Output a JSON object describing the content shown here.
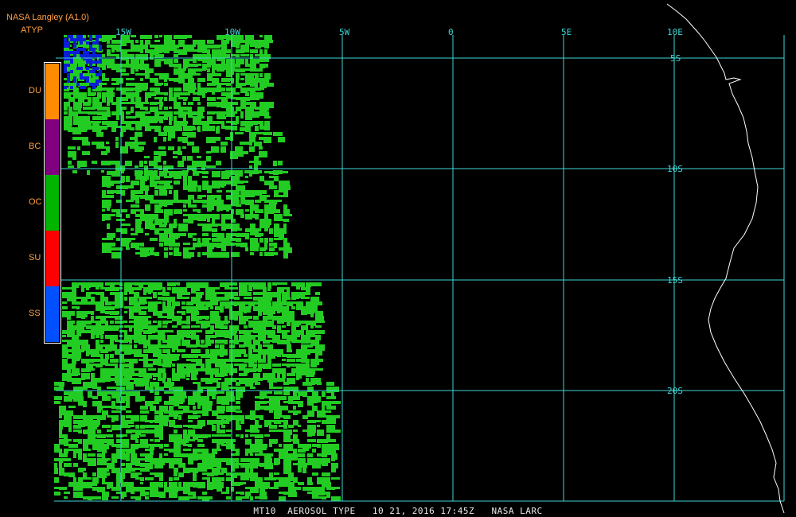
{
  "header": {
    "source": "NASA Langley (A1.0)",
    "product": "ATYP"
  },
  "legend": [
    {
      "label": "DU",
      "color": "#ff8c00"
    },
    {
      "label": "BC",
      "color": "#800080"
    },
    {
      "label": "OC",
      "color": "#00b400"
    },
    {
      "label": "SU",
      "color": "#ff0000"
    },
    {
      "label": "SS",
      "color": "#0050ff"
    }
  ],
  "longitude_labels": [
    "15W",
    "10W",
    "5W",
    "0",
    "5E",
    "10E"
  ],
  "latitude_labels": [
    "5S",
    "10S",
    "15S",
    "20S"
  ],
  "footer": "MT10  AEROSOL TYPE   10 21, 2016 17:45Z   NASA LARC",
  "colors": {
    "gridline": "#3fd6d6",
    "coastline": "#ffffff",
    "aerosol_oc": "#22cc22",
    "aerosol_ss": "#0a1ed8"
  }
}
